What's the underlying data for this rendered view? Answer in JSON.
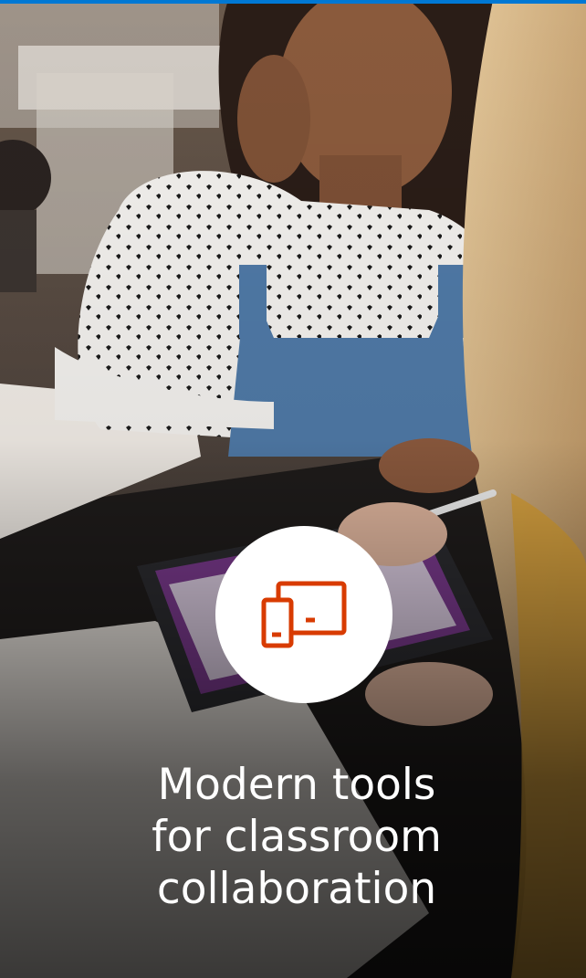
{
  "card": {
    "headline_lines": [
      "Modern tools",
      "for classroom",
      "collaboration"
    ]
  },
  "icon": {
    "name": "devices-icon",
    "color": "#d83b01"
  },
  "colors": {
    "accent_bar": "#0078d4",
    "icon_background": "#ffffff",
    "text": "#ffffff"
  }
}
